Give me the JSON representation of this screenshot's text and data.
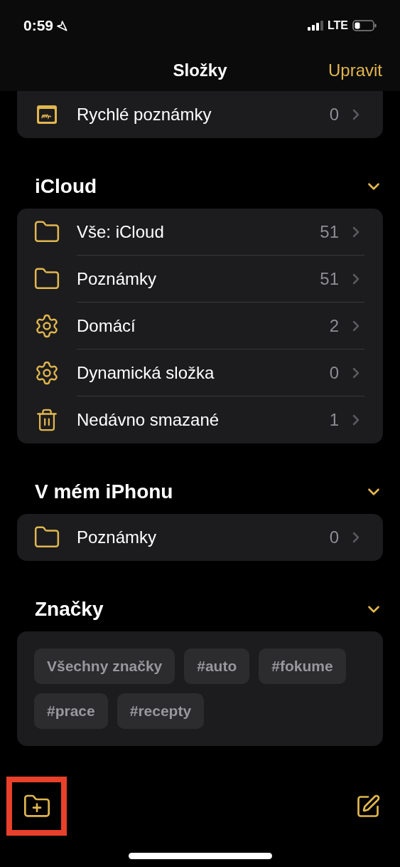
{
  "status_bar": {
    "time": "0:59",
    "network": "LTE"
  },
  "nav": {
    "title": "Složky",
    "action": "Upravit"
  },
  "quick_notes": {
    "kind": "quick-notes",
    "label": "Rychlé poznámky",
    "count": "0"
  },
  "sections": [
    {
      "title": "iCloud",
      "expanded": true,
      "kind": "folders",
      "items": [
        {
          "kind": "folder",
          "label": "Vše: iCloud",
          "count": "51"
        },
        {
          "kind": "folder",
          "label": "Poznámky",
          "count": "51"
        },
        {
          "kind": "smart",
          "label": "Domácí",
          "count": "2"
        },
        {
          "kind": "smart",
          "label": "Dynamická složka",
          "count": "0"
        },
        {
          "kind": "deleted",
          "label": "Nedávno smazané",
          "count": "1"
        }
      ]
    },
    {
      "title": "V mém iPhonu",
      "expanded": true,
      "kind": "folders",
      "items": [
        {
          "kind": "folder",
          "label": "Poznámky",
          "count": "0"
        }
      ]
    },
    {
      "title": "Značky",
      "expanded": true,
      "kind": "tags",
      "tags": [
        "Všechny značky",
        "#auto",
        "#fokume",
        "#prace",
        "#recepty"
      ]
    }
  ]
}
